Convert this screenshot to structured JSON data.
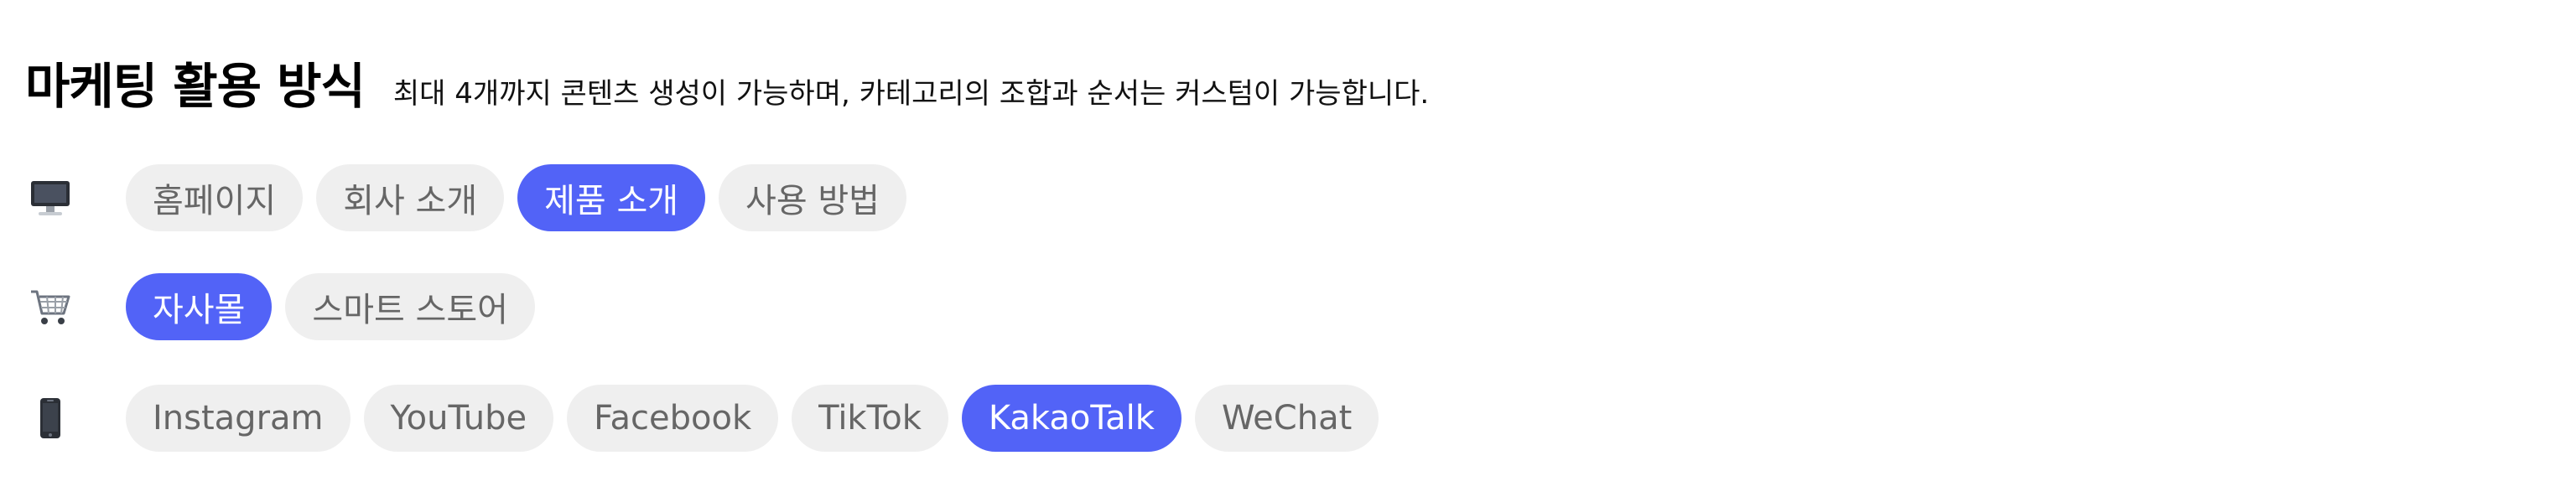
{
  "header": {
    "title": "마케팅 활용 방식",
    "subtitle": "최대 4개까지 콘텐츠 생성이 가능하며, 카테고리의 조합과 순서는 커스텀이 가능합니다."
  },
  "colors": {
    "accent": "#5263f7",
    "chip_bg": "#efefef",
    "chip_text": "#666666",
    "chip_active_text": "#ffffff"
  },
  "rows": [
    {
      "icon": "desktop-computer-icon",
      "chips": [
        {
          "label": "홈페이지",
          "selected": false
        },
        {
          "label": "회사 소개",
          "selected": false
        },
        {
          "label": "제품 소개",
          "selected": true
        },
        {
          "label": "사용 방법",
          "selected": false
        }
      ]
    },
    {
      "icon": "shopping-cart-icon",
      "chips": [
        {
          "label": "자사몰",
          "selected": true
        },
        {
          "label": "스마트 스토어",
          "selected": false
        }
      ]
    },
    {
      "icon": "mobile-phone-icon",
      "chips": [
        {
          "label": "Instagram",
          "selected": false
        },
        {
          "label": "YouTube",
          "selected": false
        },
        {
          "label": "Facebook",
          "selected": false
        },
        {
          "label": "TikTok",
          "selected": false
        },
        {
          "label": "KakaoTalk",
          "selected": true
        },
        {
          "label": "WeChat",
          "selected": false
        }
      ]
    }
  ]
}
